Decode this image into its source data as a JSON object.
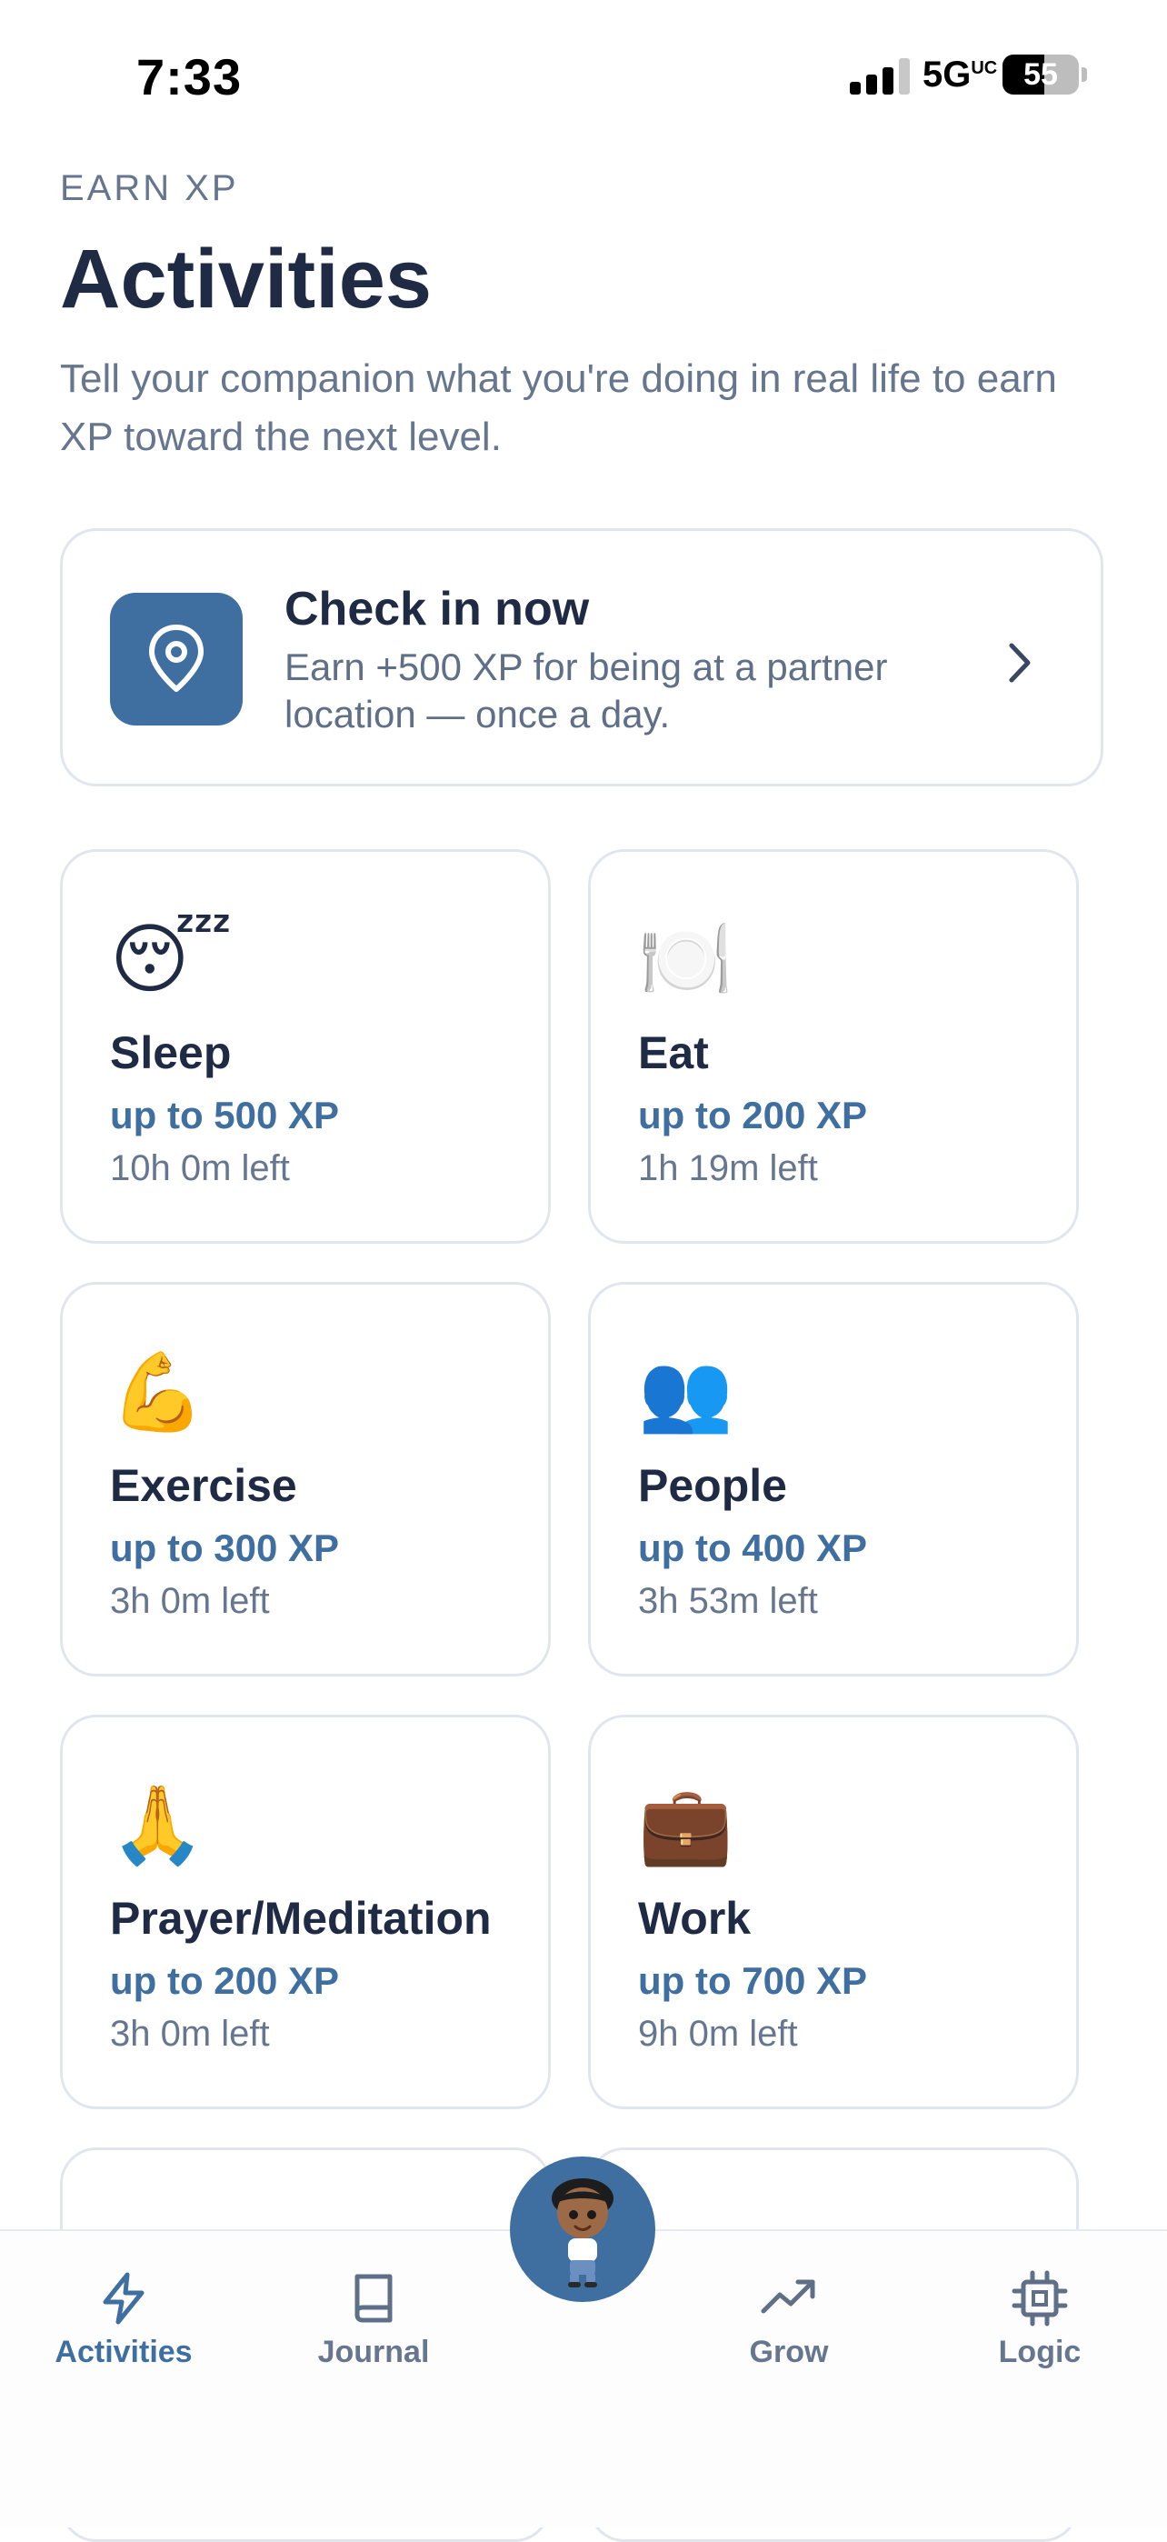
{
  "status_bar": {
    "time": "7:33",
    "network": "5G",
    "network_badge": "UC",
    "battery": "55",
    "battery_level": 0.55
  },
  "header": {
    "eyebrow": "EARN XP",
    "title": "Activities",
    "subtitle": "Tell your companion what you're doing in real life to earn XP toward the next level."
  },
  "checkin": {
    "title": "Check in now",
    "description": "Earn +500 XP for being at a partner location — once a day.",
    "icon": "location-pin-icon"
  },
  "activities": [
    {
      "emoji": "😴",
      "icon": "sleeping-face-icon",
      "name": "Sleep",
      "xp": "up to 500 XP",
      "time_left": "10h 0m left"
    },
    {
      "emoji": "🍽️",
      "icon": "plate-cutlery-icon",
      "name": "Eat",
      "xp": "up to 200 XP",
      "time_left": "1h 19m left"
    },
    {
      "emoji": "💪",
      "icon": "flexed-bicep-icon",
      "name": "Exercise",
      "xp": "up to 300 XP",
      "time_left": "3h 0m left"
    },
    {
      "emoji": "👥",
      "icon": "people-icon",
      "name": "People",
      "xp": "up to 400 XP",
      "time_left": "3h 53m left"
    },
    {
      "emoji": "🙏",
      "icon": "praying-hands-icon",
      "name": "Prayer/Meditation",
      "xp": "up to 200 XP",
      "time_left": "3h 0m left"
    },
    {
      "emoji": "💼",
      "icon": "briefcase-icon",
      "name": "Work",
      "xp": "up to 700 XP",
      "time_left": "9h 0m left"
    }
  ],
  "nav": {
    "items": [
      {
        "label": "Activities",
        "icon": "lightning-icon",
        "active": true
      },
      {
        "label": "Journal",
        "icon": "book-icon",
        "active": false
      },
      {
        "label": "Grow",
        "icon": "trending-up-icon",
        "active": false
      },
      {
        "label": "Logic",
        "icon": "chip-icon",
        "active": false
      }
    ],
    "center_icon": "companion-avatar-icon"
  },
  "colors": {
    "accent": "#3f6ea0",
    "title": "#1f2a44",
    "muted": "#66768f",
    "border": "#e1e5ee"
  }
}
